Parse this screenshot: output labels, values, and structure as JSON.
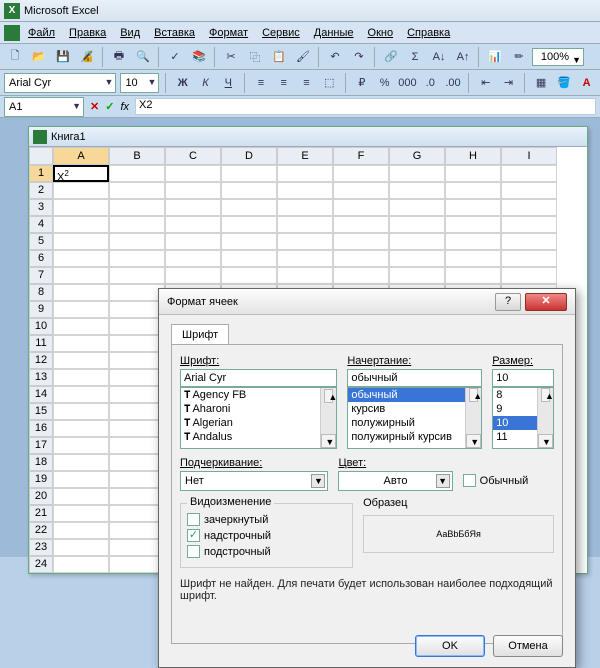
{
  "app": {
    "title": "Microsoft Excel"
  },
  "menu": {
    "file": "Файл",
    "edit": "Правка",
    "view": "Вид",
    "insert": "Вставка",
    "format": "Формат",
    "service": "Сервис",
    "data": "Данные",
    "window": "Окно",
    "help": "Справка"
  },
  "toolbar": {
    "zoom": "100%"
  },
  "fmt": {
    "font_name": "Arial Cyr",
    "font_size": "10"
  },
  "namebox": {
    "cell": "A1",
    "formula": "X2",
    "fx": "fx"
  },
  "workbook": {
    "title": "Книга1"
  },
  "columns": [
    "A",
    "B",
    "C",
    "D",
    "E",
    "F",
    "G",
    "H",
    "I"
  ],
  "cellA1": {
    "base": "X",
    "sup": "2"
  },
  "dialog": {
    "title": "Формат ячеек",
    "tab": "Шрифт",
    "font_label": "Шрифт:",
    "font_value": "Arial Cyr",
    "font_list": [
      "Agency FB",
      "Aharoni",
      "Algerian",
      "Andalus"
    ],
    "style_label": "Начертание:",
    "style_value": "обычный",
    "style_list": [
      "обычный",
      "курсив",
      "полужирный",
      "полужирный курсив"
    ],
    "style_selected": "обычный",
    "size_label": "Размер:",
    "size_value": "10",
    "size_list": [
      "8",
      "9",
      "10",
      "11"
    ],
    "size_selected": "10",
    "underline_label": "Подчеркивание:",
    "underline_value": "Нет",
    "color_label": "Цвет:",
    "color_value": "Авто",
    "normal_chk": "Обычный",
    "effects_title": "Видоизменение",
    "strike": "зачеркнутый",
    "superscript": "надстрочный",
    "subscript": "подстрочный",
    "sample_title": "Образец",
    "sample_text": "АаBbБбЯя",
    "message": "Шрифт не найден. Для печати будет использован наиболее подходящий шрифт.",
    "ok": "OK",
    "cancel": "Отмена"
  }
}
